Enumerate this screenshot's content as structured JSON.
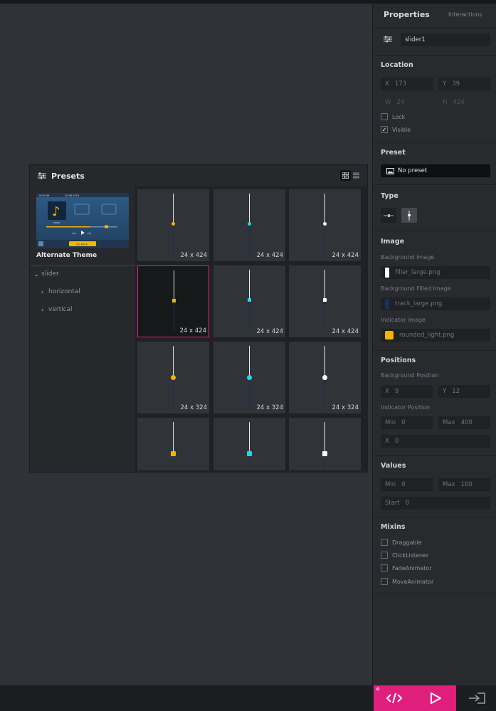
{
  "presets_panel": {
    "title": "Presets",
    "theme": {
      "label": "Alternate Theme",
      "preview_time": "9:00 AM",
      "preview_date": "20.08.2019",
      "preview_caption": "MUSIC",
      "preview_button": "GO BACK"
    },
    "tree": [
      {
        "label": "slider",
        "level": 0,
        "expanded": true
      },
      {
        "label": "horizontal",
        "level": 1,
        "expanded": false
      },
      {
        "label": "vertical",
        "level": 1,
        "expanded": false
      }
    ],
    "tiles": [
      {
        "size": "24 x 424",
        "color": "#f5b400",
        "shape": "dot",
        "selected": false
      },
      {
        "size": "24 x 424",
        "color": "#21d7e8",
        "shape": "dot",
        "selected": false
      },
      {
        "size": "24 x 424",
        "color": "#ffffff",
        "shape": "dot",
        "selected": false
      },
      {
        "size": "24 x 424",
        "color": "#f5b400",
        "shape": "square",
        "selected": true
      },
      {
        "size": "24 x 424",
        "color": "#21d7e8",
        "shape": "square",
        "selected": false
      },
      {
        "size": "24 x 424",
        "color": "#ffffff",
        "shape": "square",
        "selected": false
      },
      {
        "size": "24 x 324",
        "color": "#f5b400",
        "shape": "bigdot",
        "selected": false
      },
      {
        "size": "24 x 324",
        "color": "#21d7e8",
        "shape": "bigdot",
        "selected": false
      },
      {
        "size": "24 x 324",
        "color": "#ffffff",
        "shape": "bigdot",
        "selected": false
      },
      {
        "size": "",
        "color": "#f5b400",
        "shape": "bigsquare",
        "selected": false
      },
      {
        "size": "",
        "color": "#21d7e8",
        "shape": "bigsquare",
        "selected": false
      },
      {
        "size": "",
        "color": "#ffffff",
        "shape": "bigsquare",
        "selected": false
      }
    ]
  },
  "properties": {
    "tab_properties": "Properties",
    "tab_interactions": "Interactions",
    "name": "slider1",
    "location": {
      "title": "Location",
      "x_label": "X",
      "x": "173",
      "y_label": "Y",
      "y": "39",
      "w_label": "W",
      "w": "24",
      "h_label": "H",
      "h": "424",
      "lock": "Lock",
      "visible": "Visible"
    },
    "preset": {
      "title": "Preset",
      "value": "No preset"
    },
    "type": {
      "title": "Type"
    },
    "image": {
      "title": "Image",
      "bg_label": "Background Image",
      "bg_value": "filler_large.png",
      "bg_color": "#ffffff",
      "filled_label": "Background Filled Image",
      "filled_value": "track_large.png",
      "filled_color": "#1b2f5a",
      "indicator_label": "Indicator Image",
      "indicator_value": "rounded_light.png",
      "indicator_color": "#f5b400"
    },
    "positions": {
      "title": "Positions",
      "bg_label": "Background Position",
      "bg_x_label": "X",
      "bg_x": "9",
      "bg_y_label": "Y",
      "bg_y": "12",
      "ind_label": "Indicator Position",
      "min_label": "Min",
      "min": "0",
      "max_label": "Max",
      "max": "400",
      "ind_x_label": "X",
      "ind_x": "0"
    },
    "values": {
      "title": "Values",
      "min_label": "Min",
      "min": "0",
      "max_label": "Max",
      "max": "100",
      "start_label": "Start",
      "start": "0"
    },
    "mixins": {
      "title": "Mixins",
      "items": [
        "Draggable",
        "ClickListener",
        "FadeAnimator",
        "MoveAnimator"
      ]
    }
  },
  "colors": {
    "accent": "#e01f7d",
    "yellow": "#f5b400",
    "cyan": "#21d7e8"
  }
}
